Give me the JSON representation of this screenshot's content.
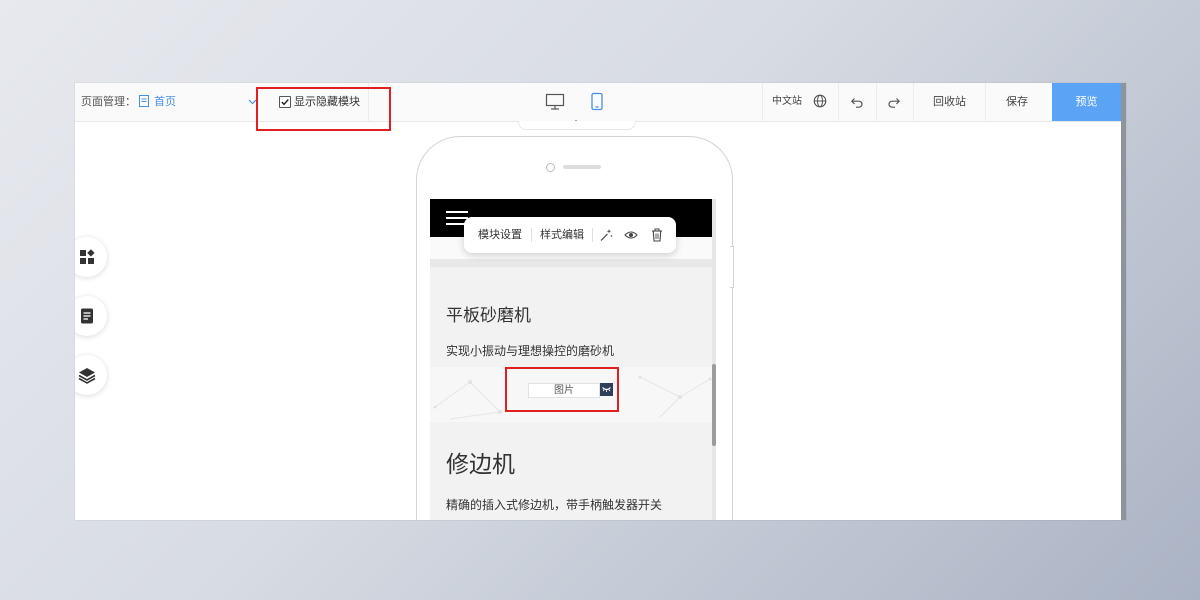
{
  "toolbar": {
    "page_label": "页面管理：",
    "page_select_value": "首页",
    "show_hidden_label": "显示隐藏模块",
    "show_hidden_checked": true,
    "language": "中文站",
    "recycle_label": "回收站",
    "save_label": "保存",
    "preview_label": "预览"
  },
  "module_toolbar": {
    "settings_label": "模块设置",
    "style_label": "样式编辑"
  },
  "phone_screen": {
    "product1_title": "平板砂磨机",
    "product1_desc": "实现小振动与理想操控的磨砂机",
    "image_chip_label": "图片",
    "product2_title": "修边机",
    "product2_desc": "精确的插入式修边机，带手柄触发器开关"
  },
  "colors": {
    "accent": "#5aa3f5",
    "select_text": "#4a90e2",
    "highlight": "#e02020",
    "chip_toggle": "#2f3e5a"
  },
  "icons": {
    "page": "page-icon",
    "desktop": "desktop-icon",
    "mobile": "mobile-icon",
    "globe": "globe-icon",
    "undo": "undo-icon",
    "redo": "redo-icon",
    "side_modules": "modules-grid-icon",
    "side_pages": "page-list-icon",
    "side_layers": "layers-icon",
    "magic": "magic-wand-icon",
    "eye": "eye-icon",
    "trash": "trash-icon"
  }
}
